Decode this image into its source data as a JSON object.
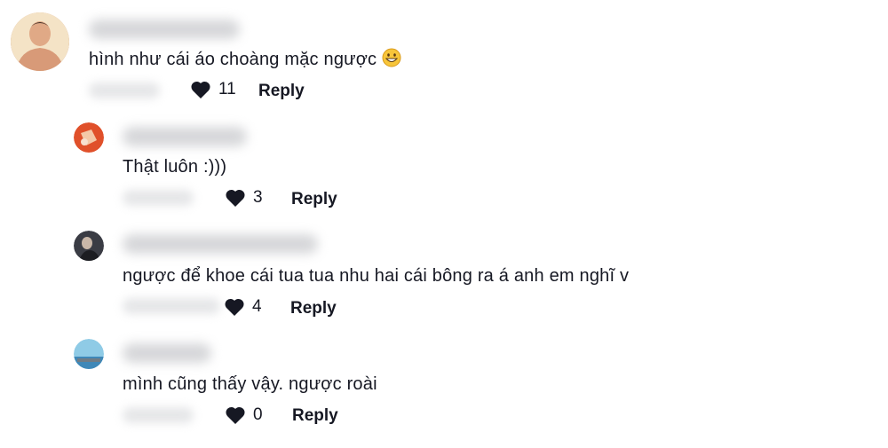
{
  "comments": [
    {
      "text": "hình như cái áo choàng mặc ngược",
      "likes": "11",
      "reply_label": "Reply",
      "emoji": "grinning-face-icon"
    },
    {
      "text": "Thật luôn :)))",
      "likes": "3",
      "reply_label": "Reply"
    },
    {
      "text": "ngược để khoe cái tua tua nhu hai cái bông ra á anh em nghĩ v",
      "likes": "4",
      "reply_label": "Reply"
    },
    {
      "text": "mình cũng thấy vậy. ngược roài",
      "likes": "0",
      "reply_label": "Reply"
    }
  ],
  "colors": {
    "text": "#161823",
    "heart": "#161823",
    "blur_name": "#cfd0d3",
    "blur_date": "#e3e4e6"
  }
}
